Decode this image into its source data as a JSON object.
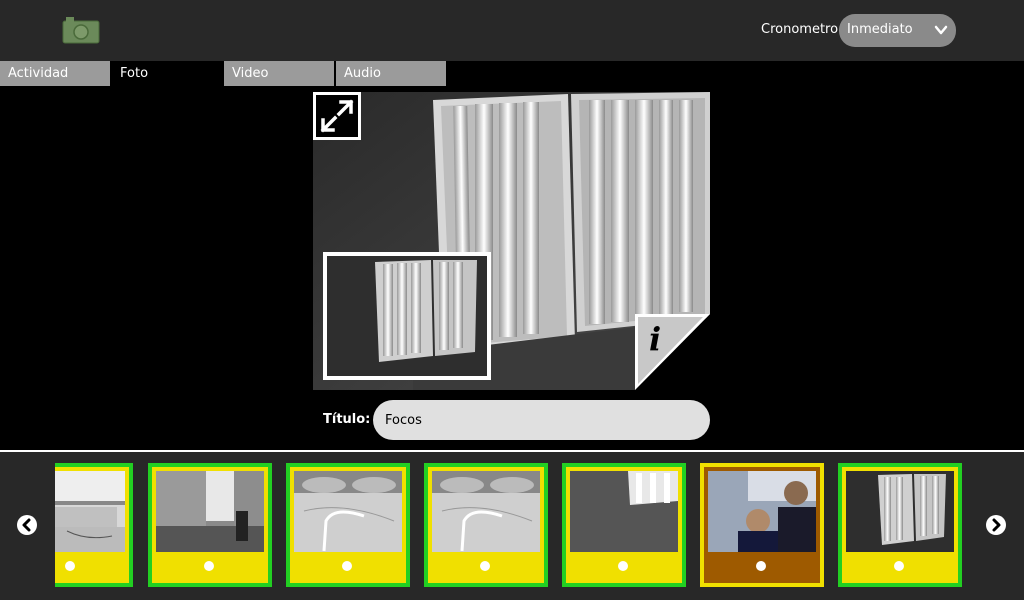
{
  "toolbar": {
    "camera_icon": "camera-icon",
    "timer_label": "Cronometro",
    "timer_value": "Inmediato"
  },
  "tabs": [
    {
      "label": "Actividad"
    },
    {
      "label": "Foto"
    },
    {
      "label": "Video"
    },
    {
      "label": "Audio"
    }
  ],
  "active_tab": "Foto",
  "viewer": {
    "expand_icon": "expand-icon",
    "info_icon": "info-icon",
    "info_glyph": "i"
  },
  "title_field": {
    "label": "Título:",
    "value": "Focos"
  },
  "tray": {
    "prev_icon": "chevron-left-icon",
    "next_icon": "chevron-right-icon",
    "thumbnails": [
      {
        "kind": "office",
        "selected": false
      },
      {
        "kind": "room",
        "selected": false
      },
      {
        "kind": "desk-cable",
        "selected": false
      },
      {
        "kind": "desk-cable",
        "selected": false
      },
      {
        "kind": "lamp-corner",
        "selected": false
      },
      {
        "kind": "people",
        "selected": true
      },
      {
        "kind": "lamps",
        "selected": false
      }
    ]
  },
  "colors": {
    "toolbar_bg": "#282828",
    "tab_inactive": "#9b9b9b",
    "thumb_border": "#22d022",
    "thumb_bg": "#f0e000",
    "thumb_selected_bg": "#9e5a00"
  }
}
